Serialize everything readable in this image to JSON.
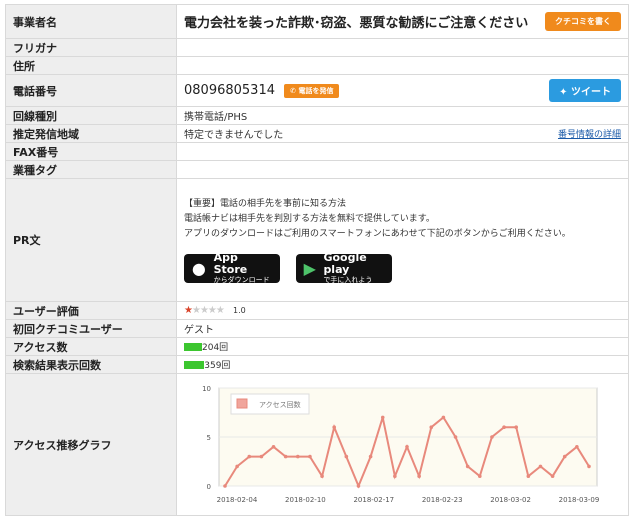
{
  "rows": {
    "name": {
      "label": "事業者名",
      "value": "電力会社を装った詐欺･窃盗、悪質な勧誘にご注意ください",
      "button": "クチコミを書く"
    },
    "furigana": {
      "label": "フリガナ",
      "value": ""
    },
    "address": {
      "label": "住所",
      "value": ""
    },
    "phone": {
      "label": "電話番号",
      "value": "08096805314",
      "call_button": "電話を発信",
      "tweet_button": "ツイート"
    },
    "line_type": {
      "label": "回線種別",
      "value": "携帯電話/PHS"
    },
    "region": {
      "label": "推定発信地域",
      "value": "特定できませんでした",
      "link": "番号情報の詳細"
    },
    "fax": {
      "label": "FAX番号",
      "value": ""
    },
    "tags": {
      "label": "業種タグ",
      "value": ""
    },
    "pr": {
      "label": "PR文",
      "lines": [
        "【重要】電話の相手先を事前に知る方法",
        "電話帳ナビは相手先を判別する方法を無料で提供しています。",
        "アプリのダウンロードはご利用のスマートフォンにあわせて下記のボタンからご利用ください。"
      ],
      "app_store": {
        "line1": "App Store",
        "line2": "からダウンロード"
      },
      "google_play": {
        "line1": "Google play",
        "line2": "で手に入れよう"
      }
    },
    "rating": {
      "label": "ユーザー評価",
      "stars": 1,
      "max": 5,
      "score": "1.0"
    },
    "first_user": {
      "label": "初回クチコミユーザー",
      "value": "ゲスト"
    },
    "access": {
      "label": "アクセス数",
      "value": "204回",
      "fill": 0.4
    },
    "search": {
      "label": "検索結果表示回数",
      "value": "359回",
      "fill": 0.45
    },
    "graph": {
      "label": "アクセス推移グラフ"
    }
  },
  "chart_data": {
    "type": "line",
    "title": "",
    "legend": "アクセス回数",
    "series": [
      {
        "name": "アクセス回数",
        "values": [
          0,
          2,
          3,
          3,
          4,
          3,
          3,
          3,
          1,
          6,
          3,
          0,
          3,
          7,
          1,
          4,
          1,
          6,
          7,
          5,
          2,
          1,
          5,
          6,
          6,
          1,
          2,
          1,
          3,
          4,
          2
        ]
      }
    ],
    "x_ticks": [
      "2018-02-04",
      "2018-02-10",
      "2018-02-17",
      "2018-02-23",
      "2018-03-02",
      "2018-03-09"
    ],
    "y_ticks": [
      "0",
      "5",
      "10"
    ],
    "ylim": [
      0,
      10
    ],
    "colors": {
      "line": "#e8897c",
      "marker": "#e8897c",
      "plot_bg": "#fdfbf1",
      "grid": "#e8e8e8"
    }
  }
}
